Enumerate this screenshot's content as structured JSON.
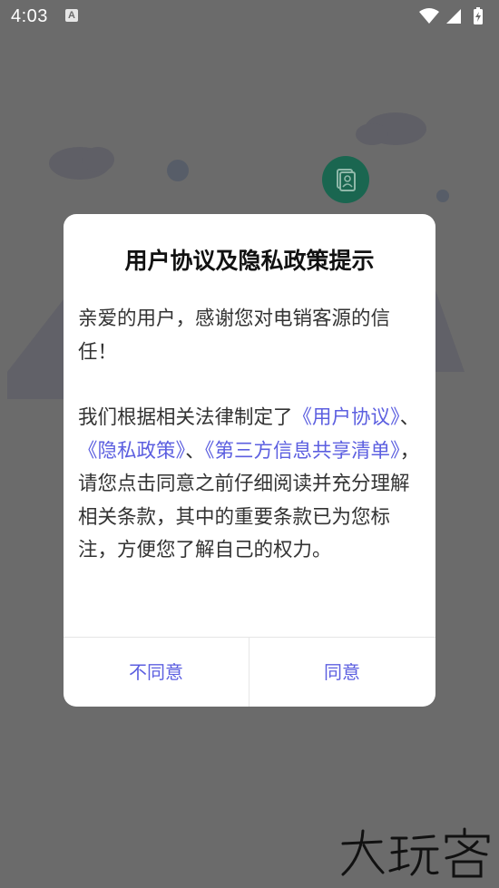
{
  "status_bar": {
    "time": "4:03",
    "notification_icon": "a-icon",
    "icons": [
      "wifi-icon",
      "cellular-signal-icon",
      "battery-charging-icon"
    ]
  },
  "dialog": {
    "title": "用户协议及隐私政策提示",
    "greeting": "亲爱的用户，感谢您对电销客源的信任！",
    "body_intro": "我们根据相关法律制定了",
    "link_user_agreement": "《用户协议》",
    "separator_1": "、",
    "link_privacy_policy": "《隐私政策》",
    "separator_2": "、",
    "link_third_party_list": "《第三方信息共享清单》",
    "body_rest": "，请您点击同意之前仔细阅读并充分理解相关条款，其中的重要条款已为您标注，方便您了解自己的权力。",
    "disagree_label": "不同意",
    "agree_label": "同意"
  },
  "watermark": "大玩客",
  "colors": {
    "overlay": "#6b6b6b",
    "dialog_bg": "#ffffff",
    "link": "#5c5fe0",
    "text": "#333333",
    "title": "#111111",
    "teal_icon": "#1a6650"
  }
}
